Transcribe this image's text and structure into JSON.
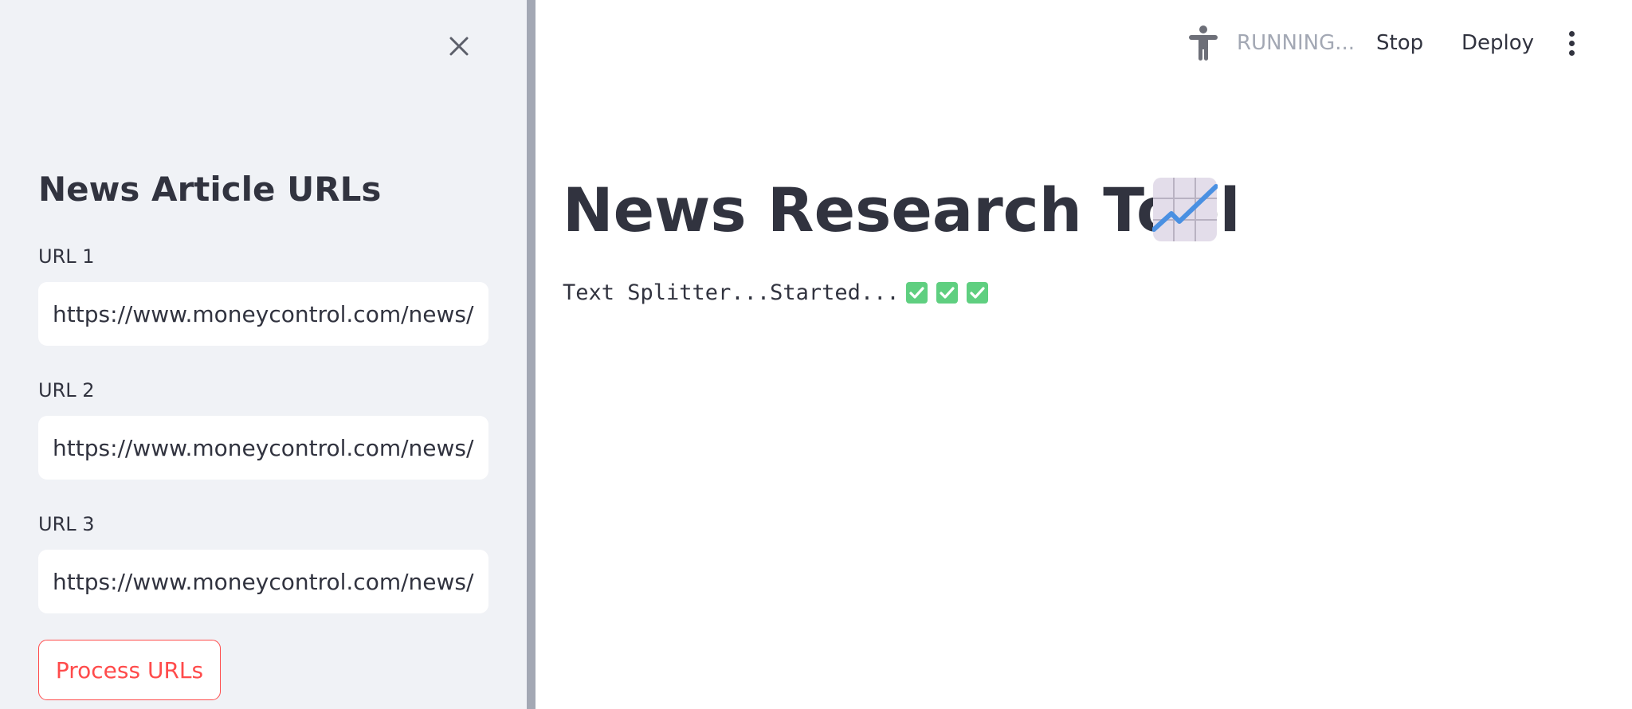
{
  "sidebar": {
    "title": "News Article URLs",
    "close_icon": "close-icon",
    "fields": [
      {
        "label": "URL 1",
        "value": "https://www.moneycontrol.com/news/business/tata-motors-mahindra-gain-certificates-for-production-linked-payouts-11281691.html"
      },
      {
        "label": "URL 2",
        "value": "https://www.moneycontrol.com/news/business/tata-motors-launches-punch-icng-price-starts-at-rs-7-1-lakh-11098751.html"
      },
      {
        "label": "URL 3",
        "value": "https://www.moneycontrol.com/news/business/stocks/buy-tata-motors-target-of-rs-743-kr-choksey-11080811.html"
      }
    ],
    "process_button_label": "Process URLs"
  },
  "toolbar": {
    "running_icon": "running-person-icon",
    "running_text": "RUNNING...",
    "stop_label": "Stop",
    "deploy_label": "Deploy",
    "menu_icon": "more-vertical-icon"
  },
  "main": {
    "title": "News Research Tool",
    "title_emoji": "chart-increasing-icon",
    "status_text": "Text Splitter...Started...",
    "status_icons": [
      "check-mark-button-icon",
      "check-mark-button-icon",
      "check-mark-button-icon"
    ]
  },
  "colors": {
    "sidebar_bg": "#f0f2f6",
    "divider": "#a3a8b4",
    "text": "#31333f",
    "accent_red": "#ff4b4b",
    "muted_text": "#a3a8b4",
    "check_green": "#5fcf80",
    "chart_line_blue": "#4a90e2",
    "chart_bg": "#e3ddea"
  }
}
